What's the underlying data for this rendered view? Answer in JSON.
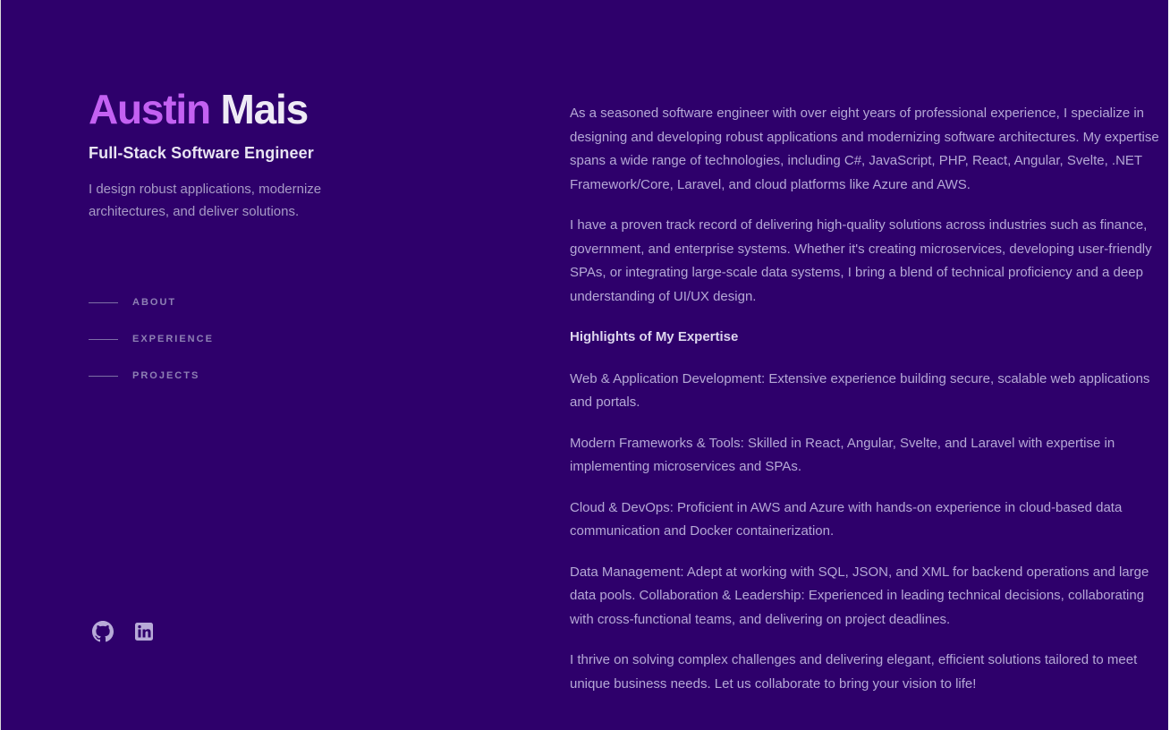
{
  "header": {
    "first_name": "Austin",
    "last_name": "Mais",
    "role": "Full-Stack Software Engineer",
    "tagline": "I design robust applications, modernize architectures, and deliver solutions."
  },
  "nav": {
    "items": [
      {
        "label": "ABOUT"
      },
      {
        "label": "EXPERIENCE"
      },
      {
        "label": "PROJECTS"
      }
    ]
  },
  "socials": {
    "items": [
      {
        "icon": "github-icon"
      },
      {
        "icon": "linkedin-icon"
      }
    ]
  },
  "about": {
    "p1": "As a seasoned software engineer with over eight years of professional experience, I specialize in designing and developing robust applications and modernizing software architectures. My expertise spans a wide range of technologies, including C#, JavaScript, PHP, React, Angular, Svelte, .NET Framework/Core, Laravel, and cloud platforms like Azure and AWS.",
    "p2": "I have a proven track record of delivering high-quality solutions across industries such as finance, government, and enterprise systems. Whether it's creating microservices, developing user-friendly SPAs, or integrating large-scale data systems, I bring a blend of technical proficiency and a deep understanding of UI/UX design.",
    "highlights_heading": "Highlights of My Expertise",
    "h1": "Web & Application Development: Extensive experience building secure, scalable web applications and portals.",
    "h2": "Modern Frameworks & Tools: Skilled in React, Angular, Svelte, and Laravel with expertise in implementing microservices and SPAs.",
    "h3": "Cloud & DevOps: Proficient in AWS and Azure with hands-on experience in cloud-based data communication and Docker containerization.",
    "h4": "Data Management: Adept at working with SQL, JSON, and XML for backend operations and large data pools. Collaboration & Leadership: Experienced in leading technical decisions, collaborating with cross-functional teams, and delivering on project deadlines.",
    "closing": "I thrive on solving complex challenges and delivering elegant, efficient solutions tailored to meet unique business needs. Let us collaborate to bring your vision to life!"
  },
  "colors": {
    "background": "#2e006b",
    "accent": "#c361f2",
    "heading_text": "#eeeaf5",
    "body_text": "#b5a8d6"
  }
}
